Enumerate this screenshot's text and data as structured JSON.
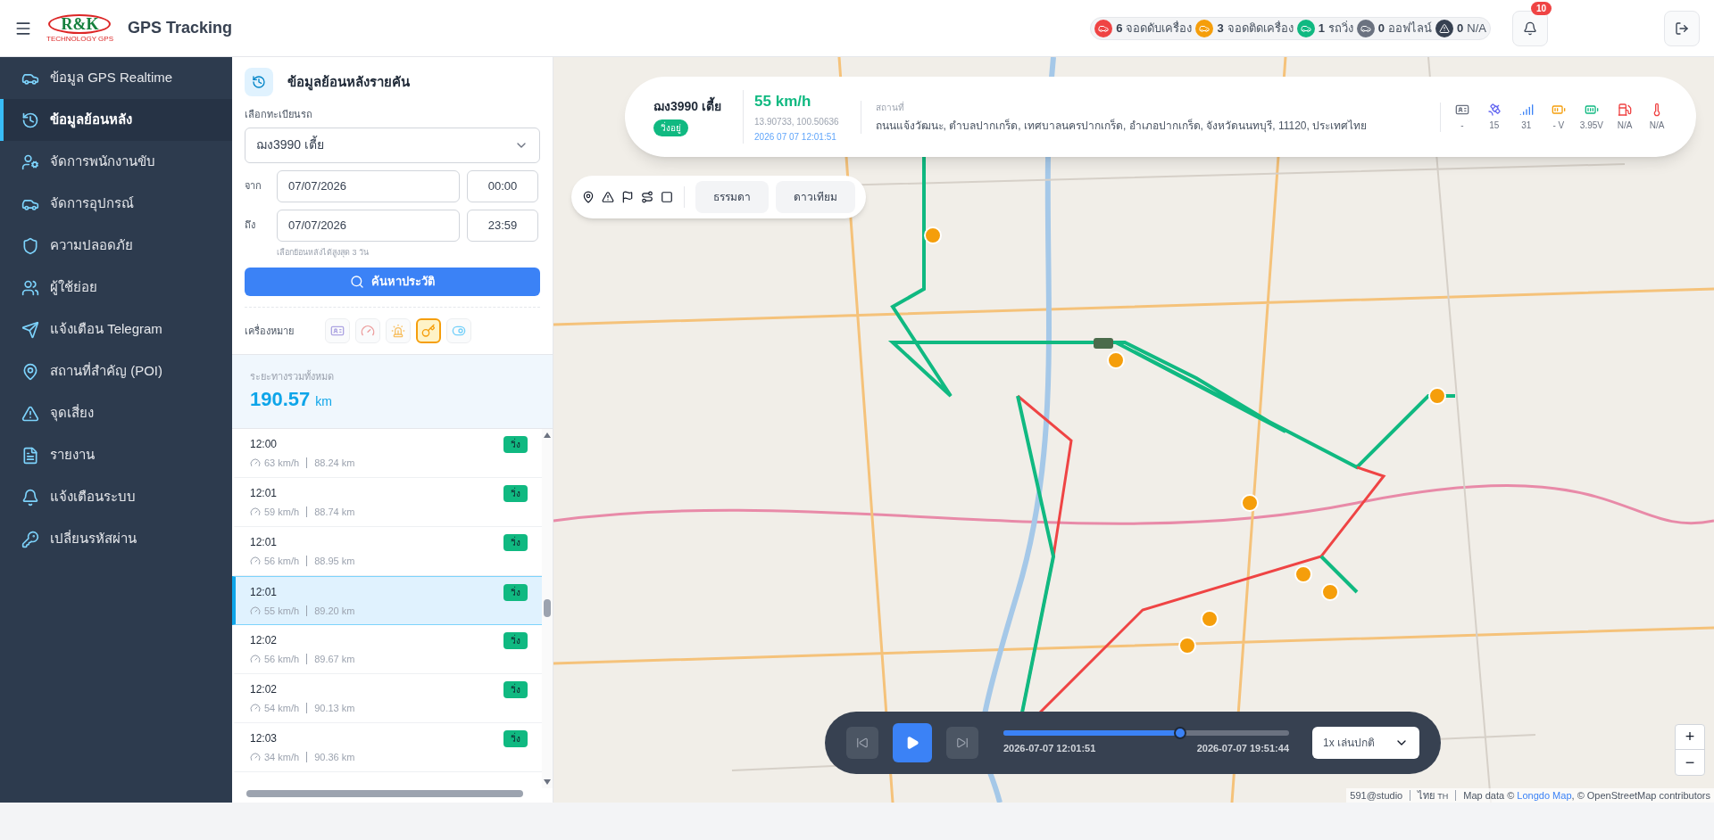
{
  "header": {
    "logo": {
      "mark": "R&K",
      "tagline": "TECHNOLOGY GPS"
    },
    "title": "GPS Tracking",
    "stats": [
      {
        "count": "6",
        "label": "จอดดับเครื่อง",
        "color": "#ef4444",
        "kind": "car"
      },
      {
        "count": "3",
        "label": "จอดติดเครื่อง",
        "color": "#f59e0b",
        "kind": "car"
      },
      {
        "count": "1",
        "label": "รถวิ่ง",
        "color": "#10b981",
        "kind": "car"
      },
      {
        "count": "0",
        "label": "ออฟไลน์",
        "color": "#6b7280",
        "kind": "car"
      },
      {
        "count": "0",
        "label": "N/A",
        "color": "#374151",
        "kind": "alert"
      }
    ],
    "notifications": "10"
  },
  "sidebar": {
    "items": [
      {
        "label": "ข้อมูล GPS Realtime",
        "selected": false
      },
      {
        "label": "ข้อมูลย้อนหลัง",
        "selected": true
      },
      {
        "label": "จัดการพนักงานขับ",
        "selected": false
      },
      {
        "label": "จัดการอุปกรณ์",
        "selected": false
      },
      {
        "label": "ความปลอดภัย",
        "selected": false
      },
      {
        "label": "ผู้ใช้ย่อย",
        "selected": false
      },
      {
        "label": "แจ้งเตือน Telegram",
        "selected": false
      },
      {
        "label": "สถานที่สำคัญ (POI)",
        "selected": false
      },
      {
        "label": "จุดเสี่ยง",
        "selected": false
      },
      {
        "label": "รายงาน",
        "selected": false
      },
      {
        "label": "แจ้งเตือนระบบ",
        "selected": false
      },
      {
        "label": "เปลี่ยนรหัสผ่าน",
        "selected": false
      }
    ]
  },
  "panel": {
    "title": "ข้อมูลย้อนหลังรายคัน",
    "vehicle_label": "เลือกทะเบียนรถ",
    "vehicle": "ฌง3990 เตี้ย",
    "from_label": "จาก",
    "from_date": "07/07/2026",
    "from_time": "00:00",
    "to_label": "ถึง",
    "to_date": "07/07/2026",
    "to_time": "23:59",
    "hint": "เลือกย้อนหลังได้สูงสุด 3 วัน",
    "search_button": "ค้นหาประวัติ",
    "markers_label": "เครื่องหมาย",
    "markers": [
      {
        "kind": "card",
        "selected": false
      },
      {
        "kind": "gauge",
        "selected": false
      },
      {
        "kind": "alarm",
        "selected": false
      },
      {
        "kind": "key",
        "selected": true
      },
      {
        "kind": "toggle",
        "selected": false
      }
    ],
    "total_label": "ระยะทางรวมทั้งหมด",
    "total_value": "190.57",
    "total_unit": "km",
    "rows": [
      {
        "time": "12:00",
        "speed": "63 km/h",
        "distance": "88.24 km",
        "status": "วิ่ง",
        "selected": false
      },
      {
        "time": "12:01",
        "speed": "59 km/h",
        "distance": "88.74 km",
        "status": "วิ่ง",
        "selected": false
      },
      {
        "time": "12:01",
        "speed": "56 km/h",
        "distance": "88.95 km",
        "status": "วิ่ง",
        "selected": false
      },
      {
        "time": "12:01",
        "speed": "55 km/h",
        "distance": "89.20 km",
        "status": "วิ่ง",
        "selected": true
      },
      {
        "time": "12:02",
        "speed": "56 km/h",
        "distance": "89.67 km",
        "status": "วิ่ง",
        "selected": false
      },
      {
        "time": "12:02",
        "speed": "54 km/h",
        "distance": "90.13 km",
        "status": "วิ่ง",
        "selected": false
      },
      {
        "time": "12:03",
        "speed": "34 km/h",
        "distance": "90.36 km",
        "status": "วิ่ง",
        "selected": false
      }
    ]
  },
  "info_card": {
    "plate": "ฌง3990 เตี้ย",
    "status": "วิ่งอยู่",
    "speed": "55 km/h",
    "coords": "13.90733, 100.50636",
    "datetime": "2026 07 07 12:01:51",
    "location_label": "สถานที่",
    "address": "ถนนแจ้งวัฒนะ, ตำบลปากเกร็ด, เทศบาลนครปากเกร็ด, อำเภอปากเกร็ด, จังหวัดนนทบุรี, 11120, ประเทศไทย",
    "sensors": [
      {
        "kind": "card",
        "value": "-"
      },
      {
        "kind": "satellite",
        "value": "15"
      },
      {
        "kind": "signal",
        "value": "31"
      },
      {
        "kind": "accumulator",
        "value": "- V"
      },
      {
        "kind": "battery",
        "value": "3.95V"
      },
      {
        "kind": "fuel",
        "value": "N/A"
      },
      {
        "kind": "temperature",
        "value": "N/A"
      }
    ]
  },
  "map_toolbar": {
    "map_types": [
      "ธรรมดา",
      "ดาวเทียม"
    ]
  },
  "player": {
    "start": "2026-07-07 12:01:51",
    "end": "2026-07-07 19:51:44",
    "level": 0.62,
    "speed_option": "1x เล่นปกติ"
  },
  "zoom": {
    "in": "+",
    "out": "−"
  },
  "attribution": {
    "studio": "591@studio",
    "language": "ไทย",
    "lang_code": "TH",
    "text": "Map data ©",
    "link": "Longdo Map",
    "suffix": ", © OpenStreetMap contributors"
  }
}
